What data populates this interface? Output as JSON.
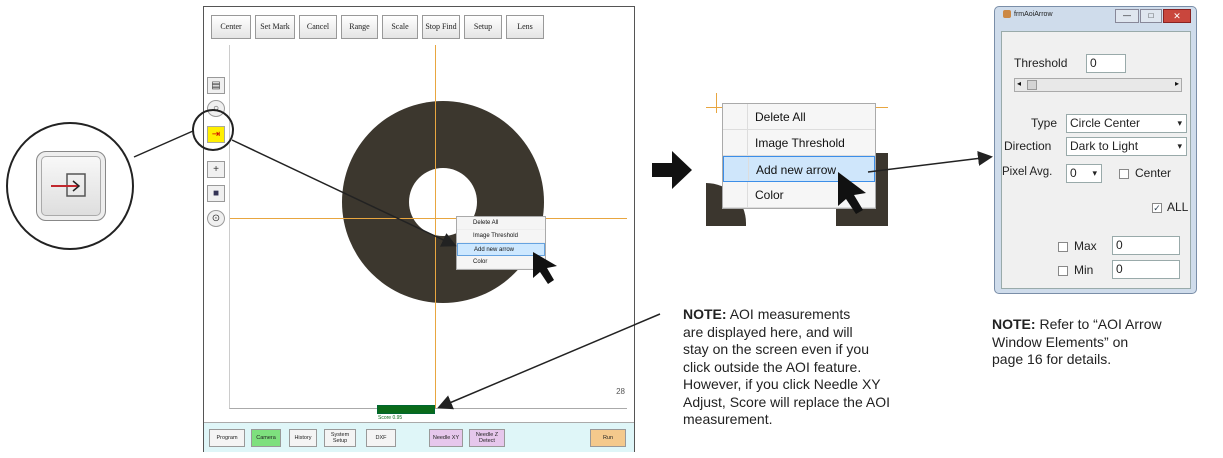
{
  "toolbar": {
    "buttons": [
      "Center",
      "Set Mark",
      "Cancel",
      "Range",
      "Scale",
      "Stop Find",
      "Setup",
      "Lens"
    ]
  },
  "side_icons": [
    "ruler-icon",
    "circle-icon",
    "add-arrow-icon",
    "crosshair-plus-icon",
    "save-icon",
    "target-icon"
  ],
  "context_menu": {
    "items": [
      "Delete All",
      "Image Threshold",
      "Add new arrow",
      "Color"
    ],
    "selected": "Add new arrow"
  },
  "score_text": "Score 0.95",
  "view_corner": "28",
  "bottom_bar": {
    "buttons": [
      "Program",
      "Camera",
      "History",
      "System Setup",
      "DXF",
      "Needle XY",
      "Needle Z Detect",
      "Run"
    ]
  },
  "frm_window": {
    "title": "frmAoiArrow",
    "threshold_label": "Threshold",
    "threshold_value": "0",
    "threshold_slider": 0,
    "type_label": "Type",
    "type_value": "Circle Center",
    "direction_label": "Direction",
    "direction_value": "Dark to Light",
    "pixel_avg_label": "Pixel Avg.",
    "pixel_avg_value": "0",
    "center_label": "Center",
    "all_label": "ALL",
    "max_label": "Max",
    "max_value": "0",
    "min_label": "Min",
    "min_value": "0"
  },
  "notes": {
    "note1_bold": "NOTE:",
    "note1_lines": [
      "AOI measurements",
      "are displayed here, and will",
      "stay on the screen even if you",
      "click outside the AOI feature.",
      "However, if you click Needle XY",
      "Adjust, Score will replace the AOI",
      "measurement."
    ],
    "note2_bold": "NOTE:",
    "note2_lines": [
      "Refer to “AOI Arrow",
      "Window Elements” on",
      "page 16 for details."
    ]
  },
  "colors": {
    "accent_yellow": "#ffef00",
    "crosshair": "#e8a640",
    "selected_blue": "#3c8ee8",
    "score_green": "#0a6b1a",
    "bottom_bar_bg": "#dff6f8"
  }
}
